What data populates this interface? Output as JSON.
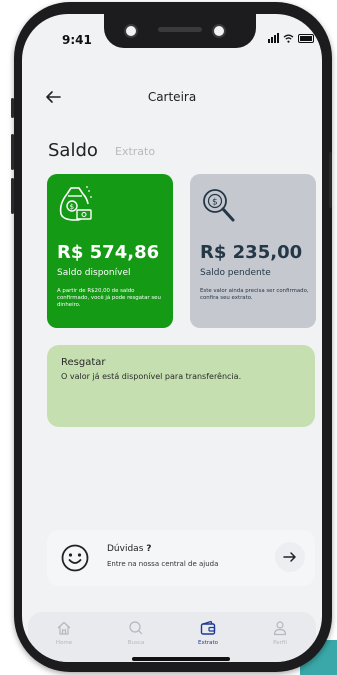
{
  "status_bar": {
    "time": "9:41"
  },
  "header": {
    "title": "Carteira"
  },
  "tabs": [
    {
      "label": "Saldo",
      "active": true
    },
    {
      "label": "Extrato",
      "active": false
    }
  ],
  "cards": {
    "available": {
      "amount": "R$ 574,86",
      "label": "Saldo disponível",
      "description": "A partir de R$20,00 de saldo confirmado, você já pode resgatar seu dinheiro.",
      "icon": "money-bag-icon",
      "color": "#149a14"
    },
    "pending": {
      "amount": "R$ 235,00",
      "label": "Saldo pendente",
      "description": "Este valor ainda precisa ser confirmado, confira seu extrato.",
      "icon": "search-money-icon",
      "color": "#c6c8d0"
    }
  },
  "resgatar": {
    "title": "Resgatar",
    "text": "O valor já está disponível para transferência.",
    "color": "#c6dfb0"
  },
  "help": {
    "title": "Dúvidas",
    "title_mark": "?",
    "subtitle": "Entre na nossa central de ajuda"
  },
  "bottom_nav": [
    {
      "label": "Home",
      "icon": "home-icon",
      "active": false
    },
    {
      "label": "Busca",
      "icon": "search-icon",
      "active": false
    },
    {
      "label": "Extrato",
      "icon": "wallet-icon",
      "active": true
    },
    {
      "label": "Perfil",
      "icon": "user-icon",
      "active": false
    }
  ],
  "colors": {
    "accent": "#1f3a93",
    "green": "#149a14"
  }
}
